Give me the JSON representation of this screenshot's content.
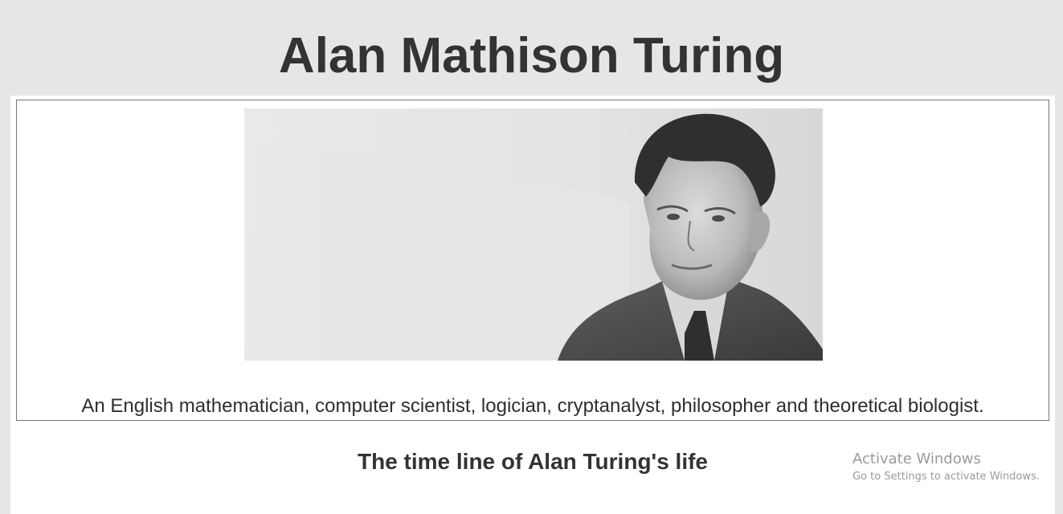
{
  "page": {
    "title": "Alan Mathison Turing"
  },
  "hero": {
    "image_description_icon": "portrait-photo",
    "caption": "An English mathematician, computer scientist, logician, cryptanalyst, philosopher and theoretical biologist."
  },
  "timeline": {
    "heading": "The time line of Alan Turing's life"
  },
  "os_watermark": {
    "title": "Activate Windows",
    "subtitle": "Go to Settings to activate Windows."
  },
  "colors": {
    "page_background": "#e6e6e6",
    "content_background": "#ffffff",
    "text": "#333333",
    "border": "#777777",
    "watermark_text": "#9a9a9a"
  }
}
